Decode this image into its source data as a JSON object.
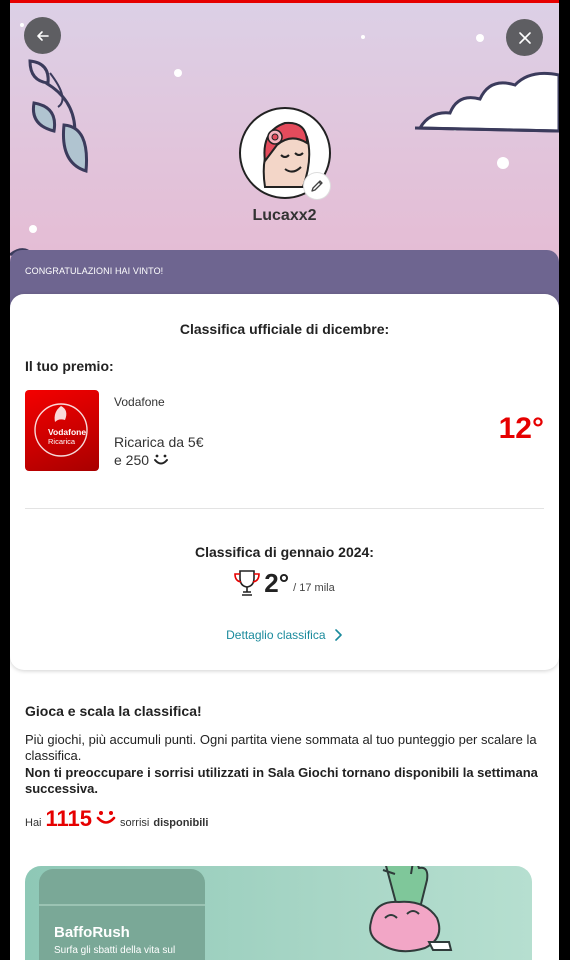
{
  "header": {
    "username": "Lucaxx2"
  },
  "banner": {
    "text": "CONGRATULAZIONI HAI VINTO!"
  },
  "card": {
    "title": "Classifica ufficiale di dicembre:",
    "prize_label": "Il tuo premio:",
    "prize": {
      "brand": "Vodafone",
      "logo_line1": "Vodafone",
      "logo_line2": "Ricarica",
      "desc_line1": "Ricarica da 5€",
      "desc_line2": "e 250",
      "rank": "12°"
    },
    "january": {
      "title": "Classifica di gennaio 2024:",
      "position": "2°",
      "total": "/ 17 mila"
    },
    "detail_link": "Dettaglio classifica"
  },
  "section": {
    "title": "Gioca e scala la classifica!",
    "body": "Più giochi, più accumuli punti. Ogni partita viene sommata al tuo punteggio per scalare la classifica.",
    "bold": "Non ti preoccupare i sorrisi utilizzati in Sala Giochi tornano disponibili la settimana successiva.",
    "points": {
      "prefix": "Hai",
      "value": "1115",
      "unit": "sorrisi",
      "suffix": "disponibili"
    }
  },
  "game": {
    "name": "BaffoRush",
    "desc": "Surfa gli sbatti della vita sul"
  },
  "colors": {
    "accent": "#e60000",
    "band": "#6e6590",
    "link": "#1a8a9c"
  }
}
